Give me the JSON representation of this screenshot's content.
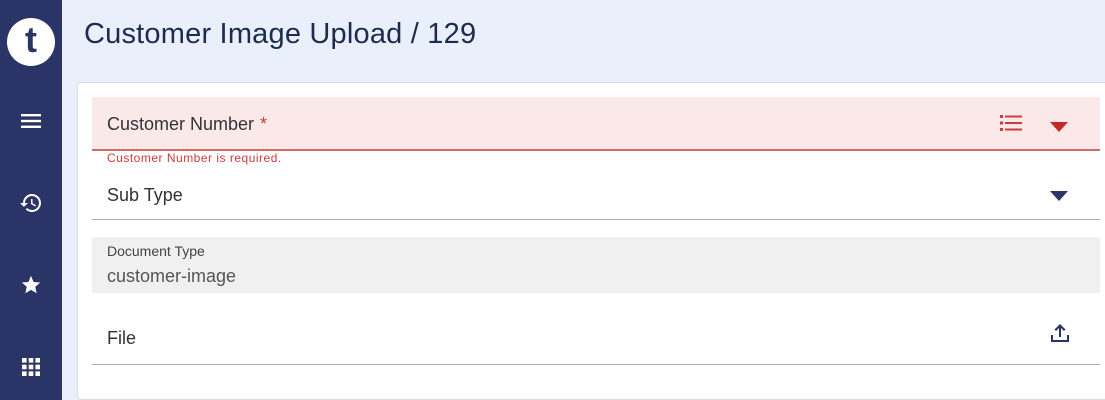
{
  "app": {
    "logo_letter": "t"
  },
  "sidebar": {
    "items": [
      {
        "icon": "menu-icon"
      },
      {
        "icon": "history-icon"
      },
      {
        "icon": "star-icon"
      },
      {
        "icon": "apps-grid-icon"
      }
    ]
  },
  "header": {
    "title": "Customer Image Upload / 129"
  },
  "form": {
    "customer_number": {
      "label": "Customer Number",
      "required_mark": "*",
      "error": "Customer Number is required.",
      "value": ""
    },
    "sub_type": {
      "label": "Sub Type",
      "value": ""
    },
    "document_type": {
      "label": "Document Type",
      "value": "customer-image"
    },
    "file": {
      "label": "File",
      "value": ""
    }
  },
  "colors": {
    "sidebar": "#2b3467",
    "error": "#d03a3a",
    "accent": "#2b3467"
  }
}
